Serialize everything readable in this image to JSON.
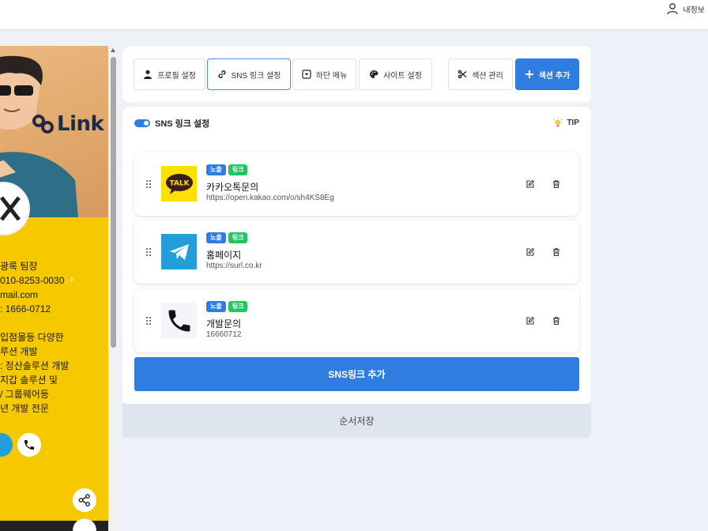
{
  "header": {
    "user_label": "내정보"
  },
  "preview": {
    "brand": "Link",
    "lines": [
      "광록 팀장",
      "010-8253-0030✨",
      "mail.com",
      ": 1666-0712",
      "",
      "입점몰등 다양한",
      "루션 개발",
      ": 정산솔루션 개발",
      "지갑 솔루션 및",
      "/ 그룹웨어등",
      "년 개발 전문"
    ]
  },
  "tabs": [
    {
      "label": "프로필 설정",
      "icon": "person-icon"
    },
    {
      "label": "SNS 링크 설정",
      "icon": "link-icon"
    },
    {
      "label": "하단 메뉴",
      "icon": "dropdown-box-icon"
    },
    {
      "label": "사이트 설정",
      "icon": "palette-icon"
    },
    {
      "label": "섹션 관리",
      "icon": "scissors-icon"
    },
    {
      "label": "섹션 추가",
      "icon": "plus-icon"
    }
  ],
  "section": {
    "title": "SNS 링크 설정",
    "tip": "TIP"
  },
  "badges": {
    "visible": "노출",
    "link": "링크"
  },
  "items": [
    {
      "title": "카카오톡문의",
      "url": "https://open.kakao.com/o/sh4KS8Eg",
      "icon_text": "TALK",
      "icon": "kakaotalk-icon"
    },
    {
      "title": "홈페이지",
      "url": "https://surl.co.kr",
      "icon": "telegram-icon"
    },
    {
      "title": "개발문의",
      "url": "16660712",
      "icon": "phone-icon"
    }
  ],
  "add_button": "SNS링크 추가",
  "save_button": "순서저장",
  "colors": {
    "primary": "#2f7de1",
    "badge_green": "#22c55e",
    "kakao": "#fae100",
    "telegram": "#229ed9"
  }
}
